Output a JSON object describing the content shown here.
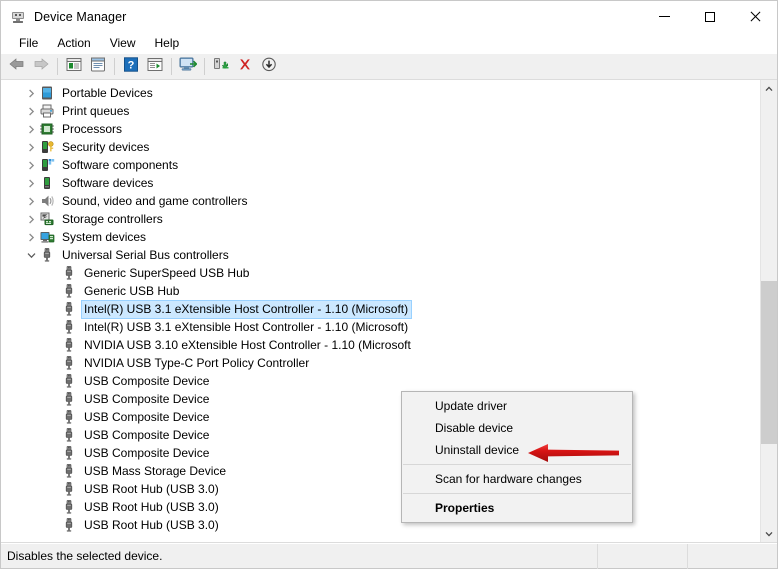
{
  "window": {
    "title": "Device Manager",
    "icon": "device-manager-icon",
    "controls": {
      "minimize": "minimize-icon",
      "maximize": "maximize-icon",
      "close": "close-icon"
    }
  },
  "menubar": {
    "items": [
      {
        "label": "File"
      },
      {
        "label": "Action"
      },
      {
        "label": "View"
      },
      {
        "label": "Help"
      }
    ]
  },
  "toolbar": {
    "buttons": [
      {
        "name": "back-icon"
      },
      {
        "name": "forward-icon"
      },
      {
        "name": "separator"
      },
      {
        "name": "show-hide-console-tree-icon"
      },
      {
        "name": "properties-icon"
      },
      {
        "name": "separator"
      },
      {
        "name": "help-icon"
      },
      {
        "name": "view-details-icon"
      },
      {
        "name": "separator"
      },
      {
        "name": "scan-for-hardware-changes-icon"
      },
      {
        "name": "separator"
      },
      {
        "name": "update-driver-icon"
      },
      {
        "name": "uninstall-device-icon"
      },
      {
        "name": "disable-device-icon"
      }
    ]
  },
  "tree": {
    "categories": [
      {
        "label": "Portable Devices",
        "icon": "portable-device-icon",
        "expanded": false
      },
      {
        "label": "Print queues",
        "icon": "printer-icon",
        "expanded": false
      },
      {
        "label": "Processors",
        "icon": "processor-icon",
        "expanded": false
      },
      {
        "label": "Security devices",
        "icon": "security-device-icon",
        "expanded": false
      },
      {
        "label": "Software components",
        "icon": "software-component-icon",
        "expanded": false
      },
      {
        "label": "Software devices",
        "icon": "software-device-icon",
        "expanded": false
      },
      {
        "label": "Sound, video and game controllers",
        "icon": "sound-device-icon",
        "expanded": false
      },
      {
        "label": "Storage controllers",
        "icon": "storage-controller-icon",
        "expanded": false
      },
      {
        "label": "System devices",
        "icon": "system-device-icon",
        "expanded": false
      },
      {
        "label": "Universal Serial Bus controllers",
        "icon": "usb-controller-icon",
        "expanded": true
      }
    ],
    "usb_devices": [
      {
        "label": "Generic SuperSpeed USB Hub",
        "selected": false
      },
      {
        "label": "Generic USB Hub",
        "selected": false
      },
      {
        "label": "Intel(R) USB 3.1 eXtensible Host Controller - 1.10 (Microsoft)",
        "selected": true
      },
      {
        "label": "Intel(R) USB 3.1 eXtensible Host Controller - 1.10 (Microsoft)",
        "selected": false
      },
      {
        "label": "NVIDIA USB 3.10 eXtensible Host Controller - 1.10 (Microsoft",
        "selected": false
      },
      {
        "label": "NVIDIA USB Type-C Port Policy Controller",
        "selected": false
      },
      {
        "label": "USB Composite Device",
        "selected": false
      },
      {
        "label": "USB Composite Device",
        "selected": false
      },
      {
        "label": "USB Composite Device",
        "selected": false
      },
      {
        "label": "USB Composite Device",
        "selected": false
      },
      {
        "label": "USB Composite Device",
        "selected": false
      },
      {
        "label": "USB Mass Storage Device",
        "selected": false
      },
      {
        "label": "USB Root Hub (USB 3.0)",
        "selected": false
      },
      {
        "label": "USB Root Hub (USB 3.0)",
        "selected": false
      },
      {
        "label": "USB Root Hub (USB 3.0)",
        "selected": false
      }
    ]
  },
  "context_menu": {
    "items": [
      {
        "label": "Update driver",
        "bold": false,
        "separator_after": false
      },
      {
        "label": "Disable device",
        "bold": false,
        "separator_after": false
      },
      {
        "label": "Uninstall device",
        "bold": false,
        "separator_after": true
      },
      {
        "label": "Scan for hardware changes",
        "bold": false,
        "separator_after": true
      },
      {
        "label": "Properties",
        "bold": true,
        "separator_after": false
      }
    ]
  },
  "annotation": {
    "arrow": "red-left-arrow",
    "color": "#d61515",
    "points_to": "Uninstall device"
  },
  "statusbar": {
    "message": "Disables the selected device."
  },
  "scrollbar": {
    "up_arrow": "chevron-up-icon",
    "down_arrow": "chevron-down-icon",
    "thumb": "scrollbar-thumb"
  },
  "colors": {
    "selection": "#cce8ff",
    "selection_border": "#99d1ff",
    "window_bg": "#f0f0f0",
    "tree_bg": "#ffffff",
    "annotation_red": "#d61515"
  }
}
